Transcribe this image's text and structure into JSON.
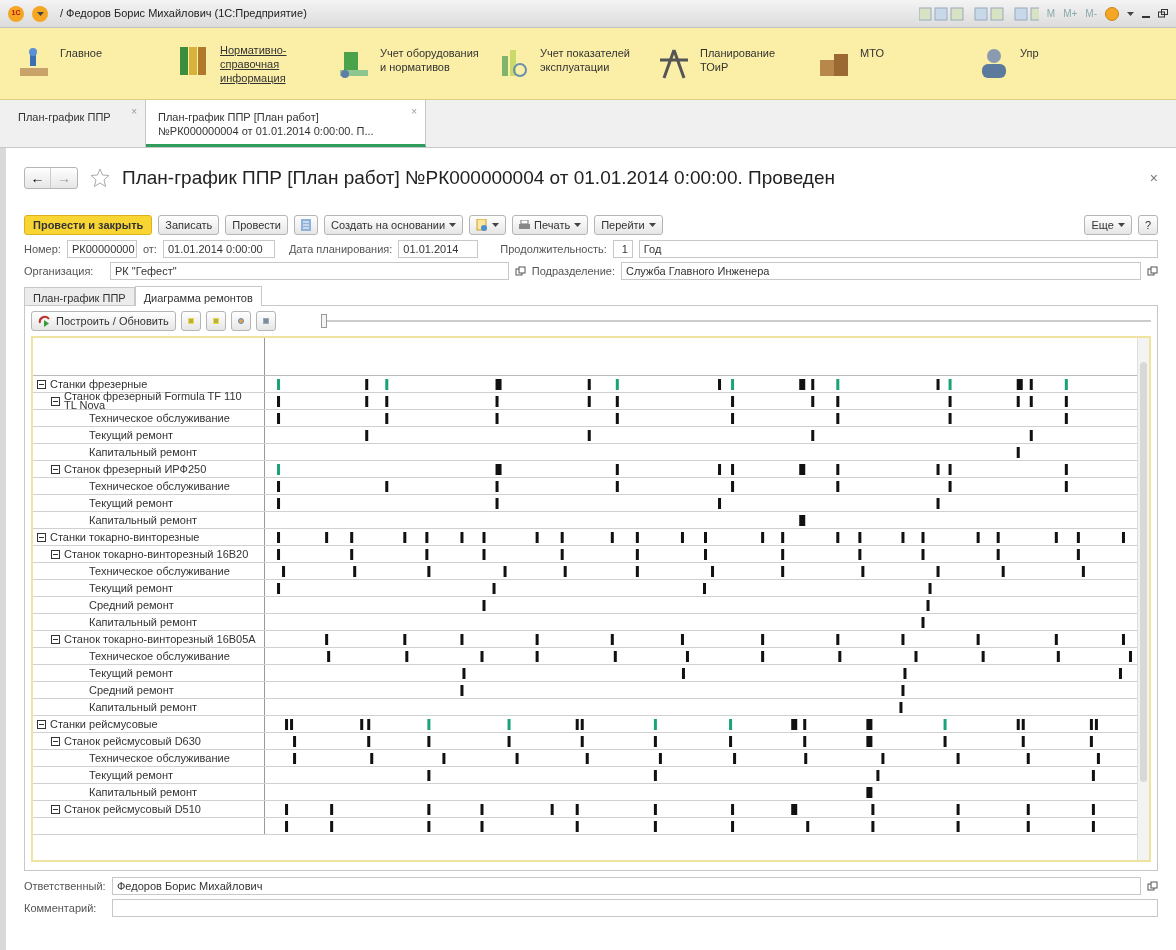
{
  "window": {
    "logo": "1С",
    "title": "/ Федоров Борис Михайлович  (1С:Предприятие)",
    "memory_buttons": [
      "M",
      "M+",
      "M-"
    ]
  },
  "sections": [
    {
      "label": "Главное",
      "selected": false,
      "kind": "desk"
    },
    {
      "label": "Нормативно-справочная информация",
      "selected": true,
      "kind": "binders"
    },
    {
      "label": "Учет оборудования и нормативов",
      "selected": false,
      "kind": "machine"
    },
    {
      "label": "Учет показателей эксплуатации",
      "selected": false,
      "kind": "chart"
    },
    {
      "label": "Планирование ТОиР",
      "selected": false,
      "kind": "tools"
    },
    {
      "label": "МТО",
      "selected": false,
      "kind": "boxes"
    },
    {
      "label": "Упр",
      "selected": false,
      "kind": "person"
    }
  ],
  "open_tabs": [
    {
      "label": "План-график ППР",
      "selected": false,
      "close": "×"
    },
    {
      "label": "План-график ППР [План работ] №РК000000004 от 01.01.2014 0:00:00. П...",
      "selected": true,
      "close": "×"
    }
  ],
  "form": {
    "back": "←",
    "forward": "→",
    "close": "×",
    "title": "План-график ППР [План работ] №РК000000004 от 01.01.2014 0:00:00. Проведен",
    "toolbar": [
      {
        "kind": "primary",
        "label": "Провести и закрыть"
      },
      {
        "kind": "button",
        "label": "Записать"
      },
      {
        "kind": "button",
        "label": "Провести"
      },
      {
        "kind": "icon"
      },
      {
        "kind": "dropdown",
        "label": "Создать на основании"
      },
      {
        "kind": "icondrop"
      },
      {
        "kind": "printdrop",
        "label": "Печать"
      },
      {
        "kind": "dropdown",
        "label": "Перейти"
      }
    ],
    "more_button": "Еще",
    "help_button": "?",
    "number_label": "Номер:",
    "number": "РК00000000",
    "date_label": "от:",
    "date": "01.01.2014  0:00:00",
    "plan_date_label": "Дата планирования:",
    "plan_date": "01.01.2014",
    "duration_label": "Продолжительность:",
    "duration": "1",
    "duration_unit": "Год",
    "org_label": "Организация:",
    "org": "РК \"Гефест\"",
    "dept_label": "Подразделение:",
    "dept": "Служба Главного Инженера",
    "inner_tabs": [
      {
        "label": "План-график ППР",
        "selected": false
      },
      {
        "label": "Диаграмма ремонтов",
        "selected": true
      }
    ],
    "build_button": "Построить / Обновить",
    "zoom_slider": {
      "level": 0
    },
    "tree": [
      {
        "label": "Станки фрезерные",
        "expanded": true,
        "children": [
          {
            "label": "Станок фрезерный Formula TF 110 TL Nova",
            "expanded": true,
            "children": [
              {
                "label": "Техническое обслуживание"
              },
              {
                "label": "Текущий ремонт"
              },
              {
                "label": "Капитальный ремонт"
              }
            ]
          },
          {
            "label": "Станок фрезерный ИРФ250",
            "expanded": true,
            "children": [
              {
                "label": "Техническое обслуживание"
              },
              {
                "label": "Текущий ремонт"
              },
              {
                "label": "Капитальный ремонт"
              }
            ]
          }
        ]
      },
      {
        "label": "Станки токарно-винторезные",
        "expanded": true,
        "children": [
          {
            "label": "Станок токарно-винторезный 16В20",
            "expanded": true,
            "children": [
              {
                "label": "Техническое обслуживание"
              },
              {
                "label": "Текущий ремонт"
              },
              {
                "label": "Средний ремонт"
              },
              {
                "label": "Капитальный ремонт"
              }
            ]
          },
          {
            "label": "Станок токарно-винторезный 16В05А",
            "expanded": true,
            "children": [
              {
                "label": "Техническое обслуживание"
              },
              {
                "label": "Текущий ремонт"
              },
              {
                "label": "Средний ремонт"
              },
              {
                "label": "Капитальный ремонт"
              }
            ]
          }
        ]
      },
      {
        "label": "Станки рейсмусовые",
        "expanded": true,
        "children": [
          {
            "label": "Станок рейсмусовый D630",
            "expanded": true,
            "children": [
              {
                "label": "Техническое обслуживание"
              },
              {
                "label": "Текущий ремонт"
              },
              {
                "label": "Капитальный ремонт"
              }
            ]
          },
          {
            "label": "Станок рейсмусовый D510",
            "expanded": true
          }
        ]
      }
    ],
    "responsible_label": "Ответственный:",
    "responsible": "Федоров Борис Михайлович",
    "comment_label": "Комментарий:"
  }
}
